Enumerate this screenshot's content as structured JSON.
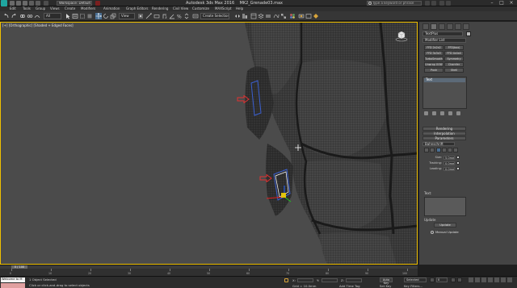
{
  "window": {
    "title": "Autodesk 3ds Max 2016",
    "file": "MK2_Grenade03.max",
    "workspace": "Workspace: Default",
    "search_placeholder": "Type a keyword or phrase"
  },
  "menu": [
    "Edit",
    "Tools",
    "Group",
    "Views",
    "Create",
    "Modifiers",
    "Animation",
    "Graph Editors",
    "Rendering",
    "Civil View",
    "Customize",
    "MAXScript",
    "Help"
  ],
  "toolbar": {
    "undo_icon": "undo-icon",
    "redo_icon": "redo-icon",
    "filter_value": "All",
    "view_value": "View",
    "selection_set_value": "Create Selection Se"
  },
  "viewport": {
    "label": "[+] [Orthographic] [Shaded + Edged Faces]",
    "active_border_color": "#f0c000",
    "background_color": "#4b4b4b",
    "mesh_color": "#3c3c3c",
    "arrow_color": "#e03030",
    "gizmo_colors": {
      "x": "#e02020",
      "y": "#20c020",
      "z": "#2060ff",
      "handle": "#f0d000"
    }
  },
  "command_panel": {
    "object_name": "TextPlus",
    "object_color": "#b8b8b8",
    "modifier_list": "Modifier List",
    "ffd_buttons": [
      "FFD 2x2x2",
      "FFD(box)",
      "FFD 3x3x3",
      "FFD 4x4x4",
      "TurboSmooth",
      "Symmetry",
      "Unwrap UVW",
      "Chamfer",
      "Push",
      "Shell"
    ],
    "stack_items": [
      "Text"
    ],
    "rollouts": [
      "Rendering",
      "Interpolation",
      "Parameters"
    ],
    "font_value": "Bahnschrift",
    "params": [
      {
        "label": "Size:",
        "value": "5.0mm"
      },
      {
        "label": "Tracking:",
        "value": "0.0mm"
      },
      {
        "label": "Leading:",
        "value": "0.0mm"
      }
    ],
    "text_label": "Text:",
    "update_label": "Update",
    "update_button": "Update",
    "manual_update_label": "Manual Update"
  },
  "timeline": {
    "slider_label": "0 / 100",
    "ticks": [
      "0",
      "10",
      "20",
      "30",
      "40",
      "50",
      "60",
      "70",
      "80",
      "90",
      "100"
    ]
  },
  "status": {
    "maxscript_text": "Welcome to M",
    "selection_status": "1 Object Selected",
    "prompt": "Click or click-and-drag to select objects",
    "x_label": "X:",
    "y_label": "Y:",
    "z_label": "Z:",
    "grid_label": "Grid = 10.0mm",
    "auto_key": "Auto Key",
    "selected_value": "Selected",
    "set_key": "Set Key",
    "key_filters": "Key Filters...",
    "add_time_tag": "Add Time Tag",
    "frame_value": "0"
  }
}
